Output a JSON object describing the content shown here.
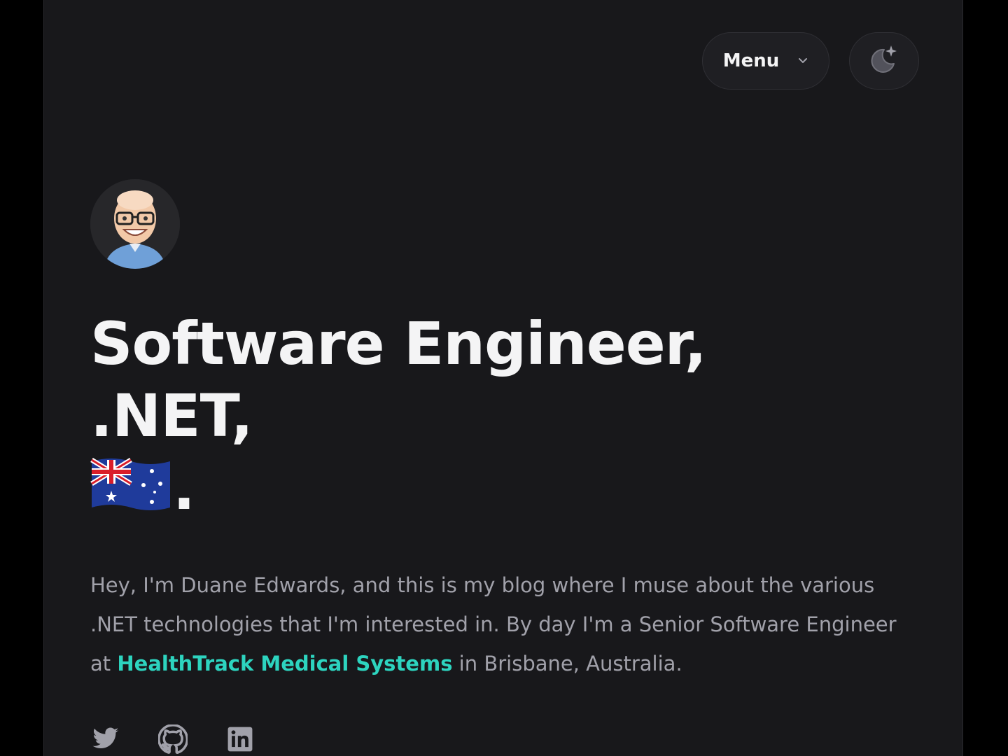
{
  "header": {
    "menu_label": "Menu",
    "menu_icon": "chevron-down-icon",
    "theme_icon": "moon-sparkle-icon"
  },
  "hero": {
    "avatar_alt": "avatar",
    "title_text": "Software Engineer, .NET,",
    "title_flag": "australia-flag-icon",
    "title_end": ".",
    "intro_before": "Hey, I'm Duane Edwards, and this is my blog where I muse about the various .NET technologies that I'm interested in. By day I'm a Senior Software Engineer at ",
    "intro_link": "HealthTrack Medical Systems",
    "intro_after": " in Brisbane, Australia."
  },
  "socials": [
    "twitter-icon",
    "github-icon",
    "linkedin-icon"
  ],
  "colors": {
    "background": "#18181b",
    "outer": "#000000",
    "text": "#f4f4f5",
    "muted": "#a1a1aa",
    "accent": "#2dd4bf"
  }
}
